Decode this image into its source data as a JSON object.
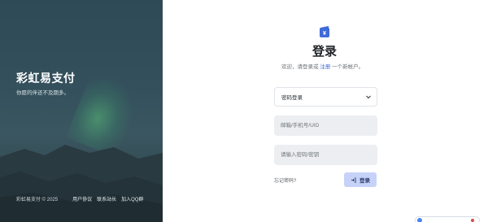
{
  "brand": {
    "title": "彩虹易支付",
    "subtitle": "你愿的伴还不及期多。"
  },
  "left_footer": {
    "copyright": "彩虹易支付 © 2025",
    "links": [
      "用户协议",
      "联系站长",
      "加入QQ群"
    ]
  },
  "login": {
    "logo_icon": "wallet-icon",
    "title": "登录",
    "subtitle_prefix": "欢迎，请登录或",
    "register_link": "注册",
    "subtitle_suffix": "一个新帐户。",
    "login_method": "密码登录",
    "email_placeholder": "邮箱/手机号/UID",
    "password_placeholder": "请输入密码/密钥",
    "forgot_label": "忘记密码?",
    "submit_label": "登录"
  },
  "colors": {
    "accent": "#3f6ad8",
    "button_bg": "#c6d2f7",
    "input_bg": "#eceef1"
  }
}
